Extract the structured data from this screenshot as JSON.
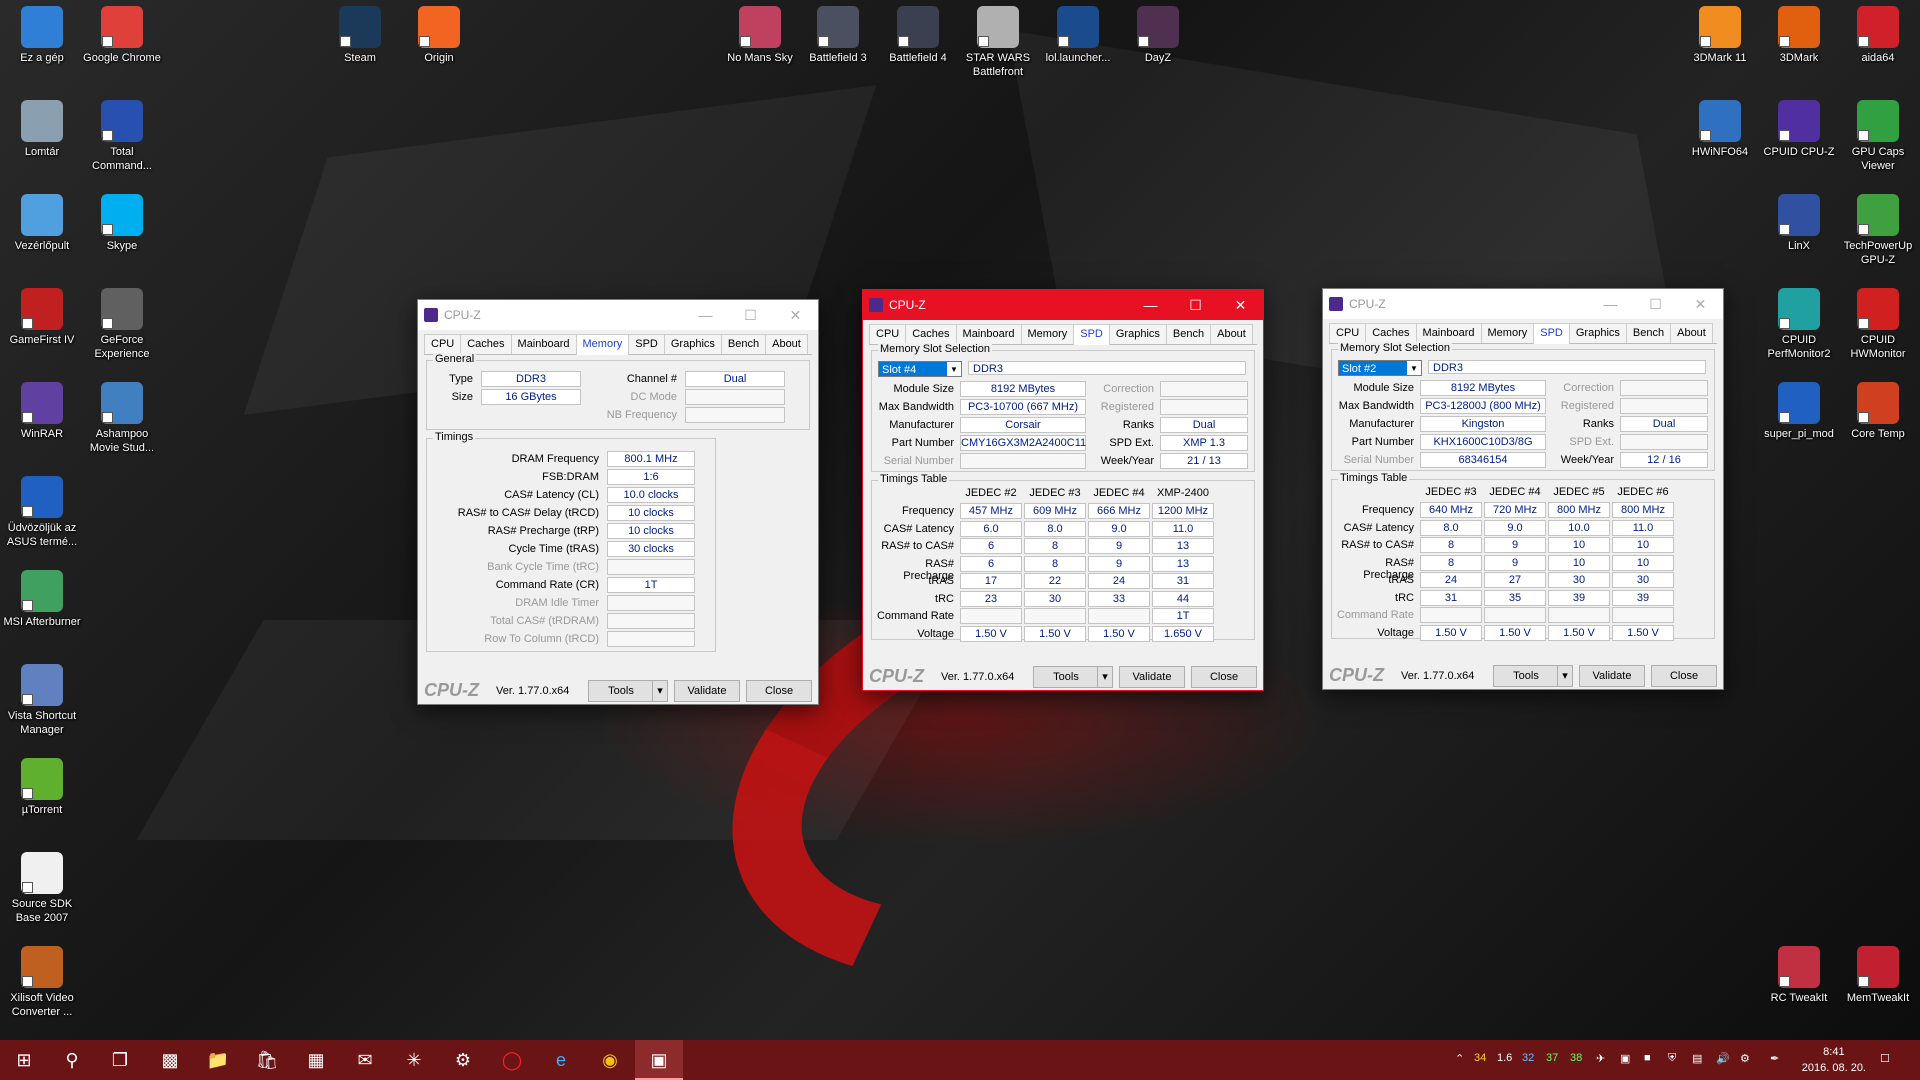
{
  "desktop": {
    "icons": [
      {
        "label": "Ez a gép",
        "icon": "computer-icon",
        "color": "#2f7fd6"
      },
      {
        "label": "Google Chrome",
        "icon": "chrome-icon",
        "color": "#e0403a"
      },
      {
        "label": "Steam",
        "icon": "steam-icon",
        "color": "#1b3a5a"
      },
      {
        "label": "Origin",
        "icon": "origin-icon",
        "color": "#f26422"
      },
      {
        "label": "No Mans Sky",
        "icon": "game-icon",
        "color": "#c04060"
      },
      {
        "label": "Battlefield 3",
        "icon": "game-icon",
        "color": "#4a5060"
      },
      {
        "label": "Battlefield 4",
        "icon": "game-icon",
        "color": "#3a4050"
      },
      {
        "label": "STAR WARS Battlefront",
        "icon": "game-icon",
        "color": "#b0b0b0"
      },
      {
        "label": "lol.launcher...",
        "icon": "game-icon",
        "color": "#1a4b8c"
      },
      {
        "label": "DayZ",
        "icon": "game-icon",
        "color": "#503050"
      },
      {
        "label": "3DMark 11",
        "icon": "benchmark-icon",
        "color": "#f08c20"
      },
      {
        "label": "3DMark",
        "icon": "benchmark-icon",
        "color": "#e06010"
      },
      {
        "label": "aida64",
        "icon": "aida-icon",
        "color": "#d0202a"
      },
      {
        "label": "Lomtár",
        "icon": "recycle-bin-icon",
        "color": "#8aa0b0"
      },
      {
        "label": "Total Command...",
        "icon": "floppy-icon",
        "color": "#2850b0"
      },
      {
        "label": "HWiNFO64",
        "icon": "hwinfo-icon",
        "color": "#3070c0"
      },
      {
        "label": "CPUID CPU-Z",
        "icon": "cpuz-icon",
        "color": "#5030a0"
      },
      {
        "label": "GPU Caps Viewer",
        "icon": "gpu-icon",
        "color": "#30a040"
      },
      {
        "label": "Vezérlőpult",
        "icon": "control-panel-icon",
        "color": "#50a0e0"
      },
      {
        "label": "Skype",
        "icon": "skype-icon",
        "color": "#00aff0"
      },
      {
        "label": "LinX",
        "icon": "linx-icon",
        "color": "#3050a0"
      },
      {
        "label": "TechPowerUp GPU-Z",
        "icon": "gpuz-icon",
        "color": "#40a040"
      },
      {
        "label": "GameFirst IV",
        "icon": "gamefirst-icon",
        "color": "#c02020"
      },
      {
        "label": "GeForce Experience",
        "icon": "geforce-icon",
        "color": "#606060"
      },
      {
        "label": "CPUID PerfMonitor2",
        "icon": "perfmonitor-icon",
        "color": "#20a0a0"
      },
      {
        "label": "CPUID HWMonitor",
        "icon": "hwmonitor-icon",
        "color": "#d02020"
      },
      {
        "label": "WinRAR",
        "icon": "winrar-icon",
        "color": "#6040a0"
      },
      {
        "label": "Ashampoo Movie Stud...",
        "icon": "ashampoo-icon",
        "color": "#4080c0"
      },
      {
        "label": "super_pi_mod",
        "icon": "superpi-icon",
        "color": "#2060c0"
      },
      {
        "label": "Core Temp",
        "icon": "thermometer-icon",
        "color": "#d04020"
      },
      {
        "label": "Üdvözöljük az ASUS termé...",
        "icon": "asus-icon",
        "color": "#2060c0"
      },
      {
        "label": "MSI Afterburner",
        "icon": "afterburner-icon",
        "color": "#40a060"
      },
      {
        "label": "Vista Shortcut Manager",
        "icon": "shortcut-icon",
        "color": "#6080c0"
      },
      {
        "label": "µTorrent",
        "icon": "utorrent-icon",
        "color": "#60b030"
      },
      {
        "label": "Source SDK Base 2007",
        "icon": "file-icon",
        "color": "#f0f0f0"
      },
      {
        "label": "Xilisoft Video Converter ...",
        "icon": "video-icon",
        "color": "#c06020"
      },
      {
        "label": "RC TweakIt",
        "icon": "tweakit-icon",
        "color": "#c03040"
      },
      {
        "label": "MemTweakIt",
        "icon": "memtweakit-icon",
        "color": "#c02030"
      }
    ]
  },
  "win1": {
    "title": "CPU-Z",
    "tabs": [
      "CPU",
      "Caches",
      "Mainboard",
      "Memory",
      "SPD",
      "Graphics",
      "Bench",
      "About"
    ],
    "active_tab": "Memory",
    "general_title": "General",
    "type_label": "Type",
    "type_value": "DDR3",
    "size_label": "Size",
    "size_value": "16 GBytes",
    "channel_label": "Channel #",
    "channel_value": "Dual",
    "dcmode_label": "DC Mode",
    "dcmode_value": "",
    "nbfreq_label": "NB Frequency",
    "nbfreq_value": "",
    "timings_title": "Timings",
    "timings": [
      {
        "label": "DRAM Frequency",
        "value": "800.1 MHz",
        "dim": false
      },
      {
        "label": "FSB:DRAM",
        "value": "1:6",
        "dim": false
      },
      {
        "label": "CAS# Latency (CL)",
        "value": "10.0 clocks",
        "dim": false
      },
      {
        "label": "RAS# to CAS# Delay (tRCD)",
        "value": "10 clocks",
        "dim": false
      },
      {
        "label": "RAS# Precharge (tRP)",
        "value": "10 clocks",
        "dim": false
      },
      {
        "label": "Cycle Time (tRAS)",
        "value": "30 clocks",
        "dim": false
      },
      {
        "label": "Bank Cycle Time (tRC)",
        "value": "",
        "dim": true
      },
      {
        "label": "Command Rate (CR)",
        "value": "1T",
        "dim": false
      },
      {
        "label": "DRAM Idle Timer",
        "value": "",
        "dim": true
      },
      {
        "label": "Total CAS# (tRDRAM)",
        "value": "",
        "dim": true
      },
      {
        "label": "Row To Column (tRCD)",
        "value": "",
        "dim": true
      }
    ],
    "version": "Ver. 1.77.0.x64",
    "tools": "Tools",
    "validate": "Validate",
    "close": "Close"
  },
  "win2": {
    "title": "CPU-Z",
    "tabs": [
      "CPU",
      "Caches",
      "Mainboard",
      "Memory",
      "SPD",
      "Graphics",
      "Bench",
      "About"
    ],
    "active_tab": "SPD",
    "slot_title": "Memory Slot Selection",
    "slot": "Slot #4",
    "mem_type": "DDR3",
    "module_size_label": "Module Size",
    "module_size": "8192 MBytes",
    "max_bw_label": "Max Bandwidth",
    "max_bw": "PC3-10700 (667 MHz)",
    "manufacturer_label": "Manufacturer",
    "manufacturer": "Corsair",
    "part_label": "Part Number",
    "part": "CMY16GX3M2A2400C11",
    "serial_label": "Serial Number",
    "serial": "",
    "correction_label": "Correction",
    "correction": "",
    "registered_label": "Registered",
    "registered": "",
    "ranks_label": "Ranks",
    "ranks": "Dual",
    "spdext_label": "SPD Ext.",
    "spdext": "XMP 1.3",
    "weekyear_label": "Week/Year",
    "weekyear": "21 / 13",
    "timings_title": "Timings Table",
    "cols": [
      "JEDEC #2",
      "JEDEC #3",
      "JEDEC #4",
      "XMP-2400"
    ],
    "rows": [
      {
        "label": "Frequency",
        "values": [
          "457 MHz",
          "609 MHz",
          "666 MHz",
          "1200 MHz"
        ]
      },
      {
        "label": "CAS# Latency",
        "values": [
          "6.0",
          "8.0",
          "9.0",
          "11.0"
        ]
      },
      {
        "label": "RAS# to CAS#",
        "values": [
          "6",
          "8",
          "9",
          "13"
        ]
      },
      {
        "label": "RAS# Precharge",
        "values": [
          "6",
          "8",
          "9",
          "13"
        ]
      },
      {
        "label": "tRAS",
        "values": [
          "17",
          "22",
          "24",
          "31"
        ]
      },
      {
        "label": "tRC",
        "values": [
          "23",
          "30",
          "33",
          "44"
        ]
      },
      {
        "label": "Command Rate",
        "values": [
          "",
          "",
          "",
          "1T"
        ]
      },
      {
        "label": "Voltage",
        "values": [
          "1.50 V",
          "1.50 V",
          "1.50 V",
          "1.650 V"
        ]
      }
    ],
    "version": "Ver. 1.77.0.x64",
    "tools": "Tools",
    "validate": "Validate",
    "close": "Close"
  },
  "win3": {
    "title": "CPU-Z",
    "tabs": [
      "CPU",
      "Caches",
      "Mainboard",
      "Memory",
      "SPD",
      "Graphics",
      "Bench",
      "About"
    ],
    "active_tab": "SPD",
    "slot_title": "Memory Slot Selection",
    "slot": "Slot #2",
    "mem_type": "DDR3",
    "module_size_label": "Module Size",
    "module_size": "8192 MBytes",
    "max_bw_label": "Max Bandwidth",
    "max_bw": "PC3-12800J (800 MHz)",
    "manufacturer_label": "Manufacturer",
    "manufacturer": "Kingston",
    "part_label": "Part Number",
    "part": "KHX1600C10D3/8G",
    "serial_label": "Serial Number",
    "serial": "68346154",
    "correction_label": "Correction",
    "correction": "",
    "registered_label": "Registered",
    "registered": "",
    "ranks_label": "Ranks",
    "ranks": "Dual",
    "spdext_label": "SPD Ext.",
    "spdext": "",
    "weekyear_label": "Week/Year",
    "weekyear": "12 / 16",
    "timings_title": "Timings Table",
    "cols": [
      "JEDEC #3",
      "JEDEC #4",
      "JEDEC #5",
      "JEDEC #6"
    ],
    "rows": [
      {
        "label": "Frequency",
        "values": [
          "640 MHz",
          "720 MHz",
          "800 MHz",
          "800 MHz"
        ]
      },
      {
        "label": "CAS# Latency",
        "values": [
          "8.0",
          "9.0",
          "10.0",
          "11.0"
        ]
      },
      {
        "label": "RAS# to CAS#",
        "values": [
          "8",
          "9",
          "10",
          "10"
        ]
      },
      {
        "label": "RAS# Precharge",
        "values": [
          "8",
          "9",
          "10",
          "10"
        ]
      },
      {
        "label": "tRAS",
        "values": [
          "24",
          "27",
          "30",
          "30"
        ]
      },
      {
        "label": "tRC",
        "values": [
          "31",
          "35",
          "39",
          "39"
        ]
      },
      {
        "label": "Command Rate",
        "values": [
          "",
          "",
          "",
          ""
        ]
      },
      {
        "label": "Voltage",
        "values": [
          "1.50 V",
          "1.50 V",
          "1.50 V",
          "1.50 V"
        ]
      }
    ],
    "version": "Ver. 1.77.0.x64",
    "tools": "Tools",
    "validate": "Validate",
    "close": "Close"
  },
  "taskbar": {
    "tray_numbers": [
      "34",
      "1.6",
      "32",
      "37",
      "38"
    ],
    "time": "8:41",
    "date": "2016. 08. 20."
  },
  "colors": {
    "accent": "#e81123",
    "value_text": "#00208a",
    "taskbar": "#6a1416"
  }
}
